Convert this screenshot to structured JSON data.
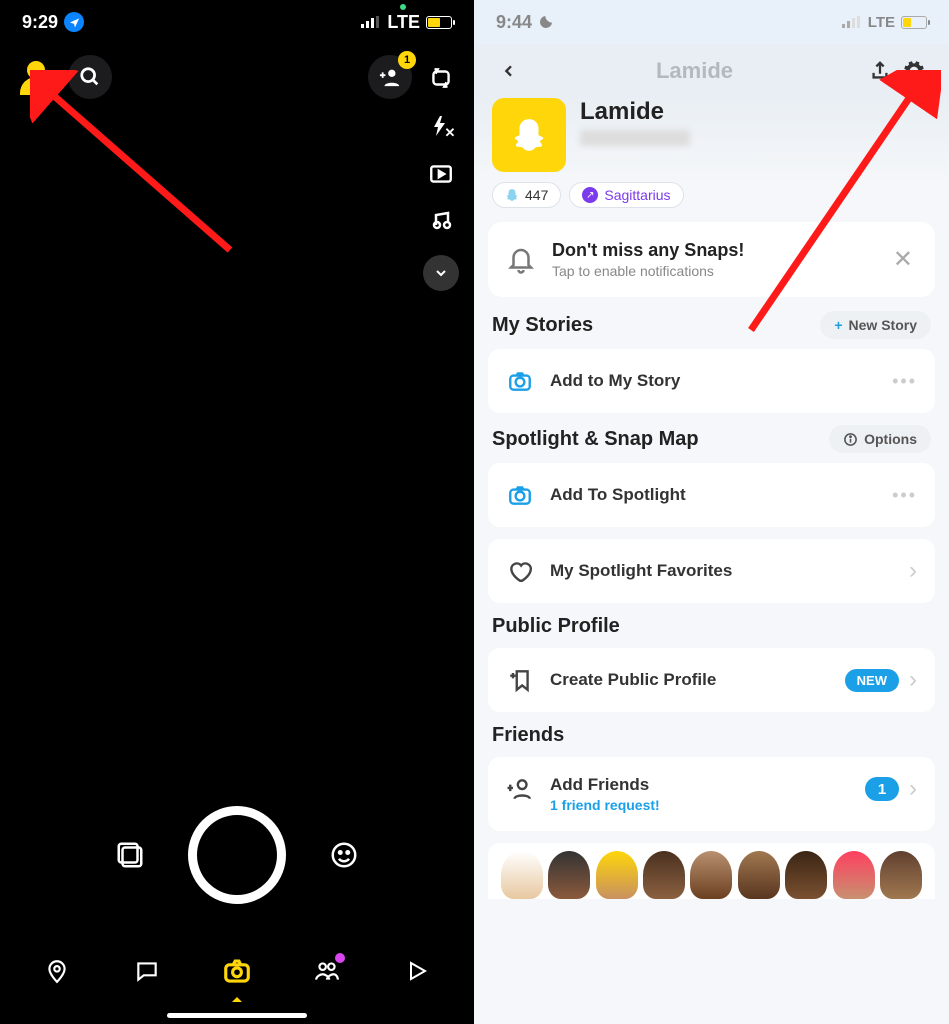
{
  "left": {
    "status_time": "9:29",
    "network": "LTE",
    "add_friend_badge": "1"
  },
  "right": {
    "status_time": "9:44",
    "network": "LTE",
    "header_title": "Lamide",
    "profile_name": "Lamide",
    "score_pill": "447",
    "zodiac_pill": "Sagittarius",
    "notif": {
      "title": "Don't miss any Snaps!",
      "subtitle": "Tap to enable notifications"
    },
    "sections": {
      "my_stories": {
        "title": "My Stories",
        "button": "New Story",
        "row": "Add to My Story"
      },
      "spotlight": {
        "title": "Spotlight & Snap Map",
        "button": "Options",
        "row_add": "Add To Spotlight",
        "row_fav": "My Spotlight Favorites"
      },
      "public": {
        "title": "Public Profile",
        "row": "Create Public Profile",
        "badge": "NEW"
      },
      "friends": {
        "title": "Friends",
        "row": "Add Friends",
        "sub": "1 friend request!",
        "count": "1"
      }
    }
  }
}
